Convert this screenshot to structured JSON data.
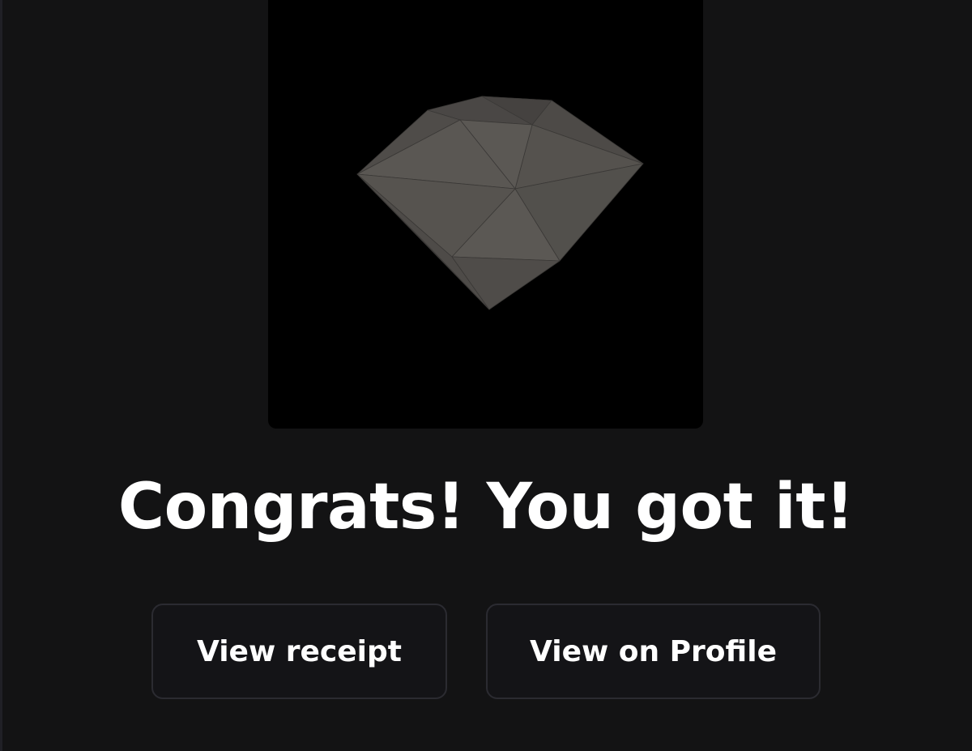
{
  "headline": "Congrats! You got it!",
  "actions": {
    "receipt_label": "View receipt",
    "profile_label": "View on Profile"
  },
  "colors": {
    "background": "#131314",
    "media_background": "#000000",
    "gem": "#5a5753",
    "button_border": "#2b2b31",
    "text": "#ffffff"
  },
  "media": {
    "subject": "gem-icon"
  }
}
